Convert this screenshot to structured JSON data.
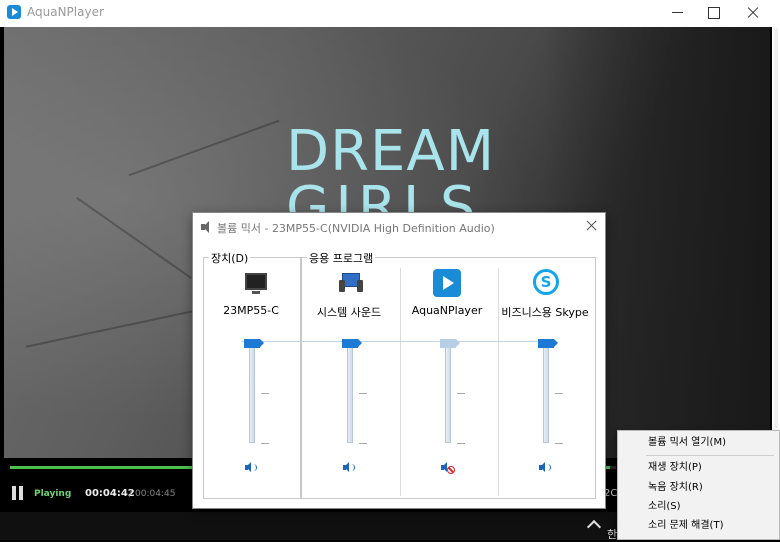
{
  "app": {
    "title": "AquaNPlayer"
  },
  "video": {
    "line1": "DREAM",
    "line2": "GIRLS"
  },
  "player": {
    "status": "Playing",
    "current_time": "00:04:42",
    "separator": "/",
    "total_time": "00:04:45",
    "progress_fraction": 0.99,
    "partial_text": "2C"
  },
  "mixer": {
    "title": "볼륨 믹서 - 23MP55-C(NVIDIA High Definition Audio)",
    "device_group_label": "장치(D)",
    "apps_group_label": "응용 프로그램",
    "channels": [
      {
        "label": "23MP55-C",
        "icon": "monitor-icon",
        "level": 1.0,
        "muted": false
      },
      {
        "label": "시스템 사운드",
        "icon": "system-sound-icon",
        "level": 1.0,
        "muted": false
      },
      {
        "label": "AquaNPlayer",
        "icon": "aquanplayer-icon",
        "level": 1.0,
        "muted": true
      },
      {
        "label": "비즈니스용 Skype",
        "icon": "skype-icon",
        "level": 1.0,
        "muted": false
      }
    ]
  },
  "context_menu": {
    "items": [
      "볼륨 믹서 열기(M)",
      "재생 장치(P)",
      "녹음 장치(R)",
      "소리(S)",
      "소리 문제 해결(T)"
    ]
  },
  "taskbar": {
    "tray_text": "한"
  },
  "colors": {
    "accent": "#1c7ad4",
    "progress": "#4cc24c",
    "title_text": "#a9e3ec",
    "mute_red": "#d4242b"
  }
}
